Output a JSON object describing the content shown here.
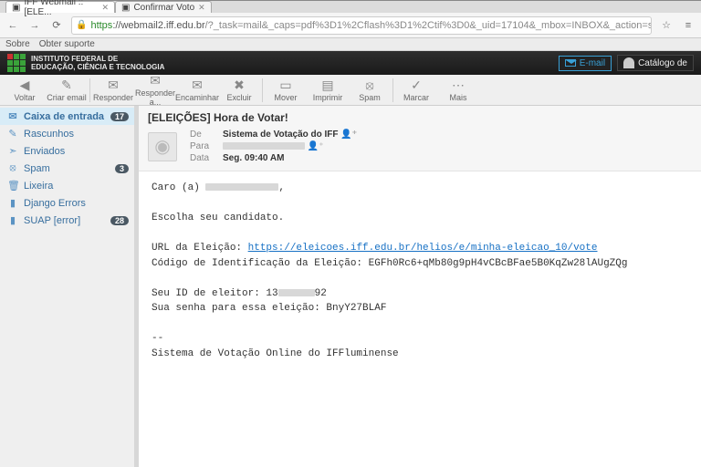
{
  "browser": {
    "tabs": [
      {
        "title": "IFF Webmail :: [ELE..."
      },
      {
        "title": "Confirmar Voto"
      }
    ],
    "url_secure": "https",
    "url_host": "://webmail2.iff.edu.br",
    "url_path": "/?_task=mail&_caps=pdf%3D1%2Cflash%3D1%2Ctif%3D0&_uid=17104&_mbox=INBOX&_action=show",
    "bookmarks": {
      "b1": "Sobre",
      "b2": "Obter suporte"
    }
  },
  "app_header": {
    "line1": "INSTITUTO FEDERAL DE",
    "line2": "EDUCAÇÃO, CIÊNCIA E TECNOLOGIA",
    "email_btn": "E-mail",
    "catalog_btn": "Catálogo de"
  },
  "toolbar": {
    "back": "Voltar",
    "compose": "Criar email",
    "reply": "Responder",
    "replyall": "Responder a...",
    "forward": "Encaminhar",
    "delete": "Excluir",
    "move": "Mover",
    "print": "Imprimir",
    "spam": "Spam",
    "mark": "Marcar",
    "more": "Mais"
  },
  "sidebar": {
    "items": [
      {
        "label": "Caixa de entrada",
        "icon": "✉",
        "badge": "17",
        "active": true
      },
      {
        "label": "Rascunhos",
        "icon": "✎"
      },
      {
        "label": "Enviados",
        "icon": "➣"
      },
      {
        "label": "Spam",
        "icon": "⚠",
        "badge": "3"
      },
      {
        "label": "Lixeira",
        "icon": "🗑"
      },
      {
        "label": "Django Errors",
        "icon": "▮"
      },
      {
        "label": "SUAP [error]",
        "icon": "▮",
        "badge": "28"
      }
    ]
  },
  "message": {
    "subject": "[ELEIÇÕES] Hora de Votar!",
    "from_label": "De",
    "from": "Sistema de Votação do IFF",
    "to_label": "Para",
    "date_label": "Data",
    "date": "Seg. 09:40 AM",
    "body": {
      "greeting": "Caro (a) ",
      "greeting_end": ",",
      "l1": "Escolha seu candidato.",
      "l2a": "URL da Eleição: ",
      "l2link": "https://eleicoes.iff.edu.br/helios/e/minha-eleicao_10/vote",
      "l3": "Código de Identificação da Eleição: EGFh0Rc6+qMb80g9pH4vCBcBFae5B0KqZw28lAUgZQg",
      "l4a": "Seu ID de eleitor: 13",
      "l4b": "92",
      "l5": "Sua senha para essa eleição: BnyY27BLAF",
      "sep": "--",
      "sig": "Sistema de Votação Online do IFFluminense"
    }
  }
}
